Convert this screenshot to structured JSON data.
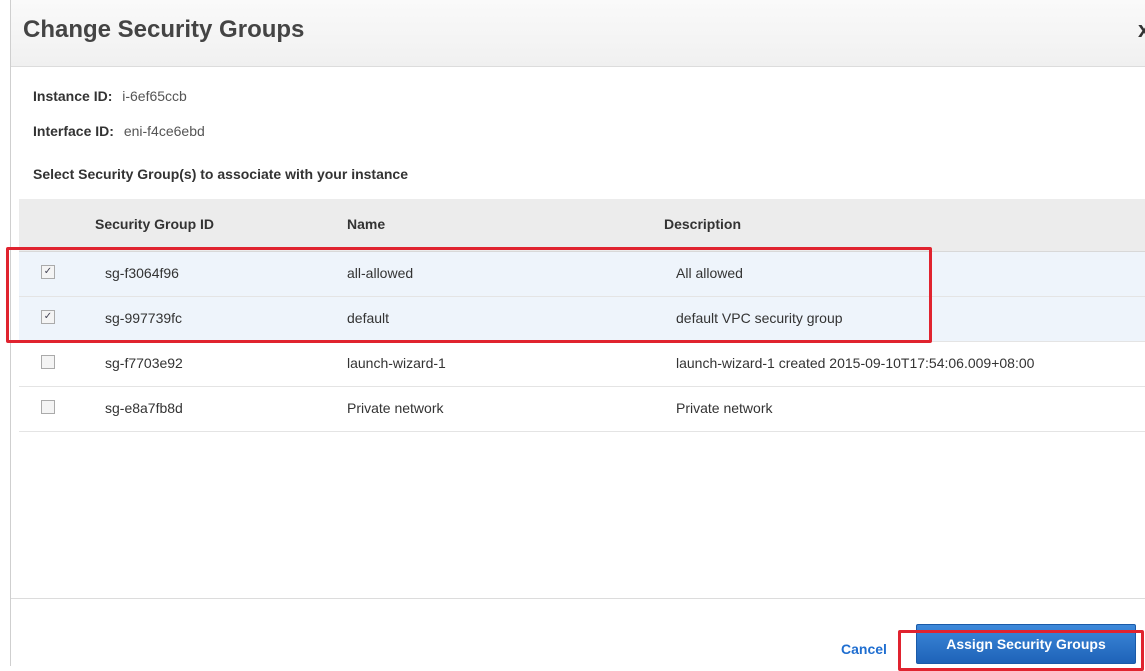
{
  "dialog": {
    "title": "Change Security Groups",
    "close_glyph": "x"
  },
  "instance": {
    "id_label": "Instance ID:",
    "id_value": "i-6ef65ccb",
    "interface_label": "Interface ID:",
    "interface_value": "eni-f4ce6ebd"
  },
  "select_heading": "Select Security Group(s) to associate with your instance",
  "table": {
    "headers": {
      "group_id": "Security Group ID",
      "name": "Name",
      "description": "Description"
    },
    "rows": [
      {
        "checked": true,
        "group_id": "sg-f3064f96",
        "name": "all-allowed",
        "description": "All allowed"
      },
      {
        "checked": true,
        "group_id": "sg-997739fc",
        "name": "default",
        "description": "default VPC security group"
      },
      {
        "checked": false,
        "group_id": "sg-f7703e92",
        "name": "launch-wizard-1",
        "description": "launch-wizard-1 created 2015-09-10T17:54:06.009+08:00"
      },
      {
        "checked": false,
        "group_id": "sg-e8a7fb8d",
        "name": "Private network",
        "description": "Private network"
      }
    ]
  },
  "footer": {
    "cancel_label": "Cancel",
    "assign_label": "Assign Security Groups"
  },
  "colors": {
    "primary_button": "#1e63b8",
    "highlight": "#e0232f",
    "selected_row": "#eef4fb"
  }
}
